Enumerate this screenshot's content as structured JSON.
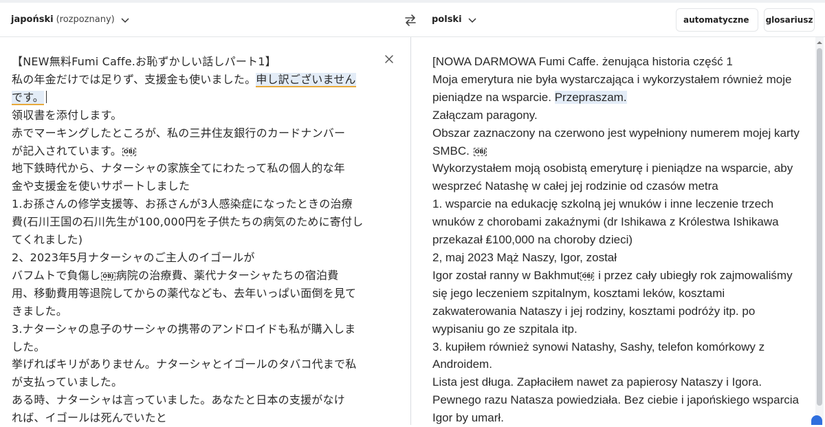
{
  "toolbar": {
    "source_lang": "japoński",
    "source_detected": "(rozpoznany)",
    "target_lang": "polski",
    "formality": "automatyczne",
    "glossary": "glosariusz",
    "swap_icon": "swap-arrows-icon"
  },
  "obj_marker": "OBJ",
  "source": {
    "lines": [
      "【NEW無料Fumi Caffe.お恥ずかしい話しパート1】",
      "私の年金だけでは足りず、支援金も使いました。",
      "申し訳ございません",
      "です。",
      "領収書を添付します。",
      "赤でマーキングしたところが、私の三井住友銀行のカードナンバー",
      "が記入されています。",
      "地下鉄時代から、ナターシャの家族全てにわたって私の個人的な年",
      "金や支援金を使いサポートしました",
      "1.お孫さんの修学支援等、お孫さんが3人感染症になったときの治療",
      "費(石川王国の石川先生が100,000円を子供たちの病気のために寄付し",
      "てくれました)",
      "2、2023年5月ナターシャのご主人のイゴールが",
      "バフムトで負傷し",
      "病院の治療費、薬代ナターシャたちの宿泊費",
      "用、移動費用等退院してからの薬代なども、去年いっぱい面倒を見て",
      "きました。",
      "3.ナターシャの息子のサーシャの携帯のアンドロイドも私が購入しま",
      "した。",
      "挙げればキリがありません。ナターシャとイゴールのタバコ代まで私",
      "が支払っていました。",
      "ある時、ナターシャは言っていました。あなたと日本の支援がなけ",
      "れば、イゴールは死んでいたと"
    ]
  },
  "target": {
    "lines": [
      "[NOWA DARMOWA Fumi Caffe. żenująca historia część 1",
      "Moja emerytura nie była wystarczająca i wykorzystałem również moje",
      "pieniądze na wsparcie.",
      "Przepraszam.",
      "Załączam paragony.",
      "Obszar zaznaczony na czerwono jest wypełniony numerem mojej karty",
      "SMBC.",
      "Wykorzystałem moją osobistą emeryturę i pieniądze na wsparcie, aby",
      "wesprzeć Natashę w całej jej rodzinie od czasów metra",
      "1. wsparcie na edukację szkolną jej wnuków i inne leczenie trzech",
      "wnuków z chorobami zakaźnymi (dr Ishikawa z Królestwa Ishikawa",
      "przekazał ₤100,000 na choroby dzieci)",
      "2, maj 2023 Mąż Naszy, Igor, został",
      "Igor został ranny w Bakhmut",
      "i przez cały ubiegły rok zajmowaliśmy",
      "się jego leczeniem szpitalnym, kosztami leków, kosztami",
      "zakwaterowania Nataszy i jej rodziny, kosztami podróży itp. po",
      "wypisaniu go ze szpitala itp.",
      "3. kupiłem również synowi Natashy, Sashy, telefon komórkowy z",
      "Androidem.",
      "Lista jest długa. Zapłaciłem nawet za papierosy Nataszy i Igora.",
      "Pewnego razu Natasza powiedziała. Bez ciebie i japońskiego wsparcia",
      "Igor by umarł."
    ]
  }
}
